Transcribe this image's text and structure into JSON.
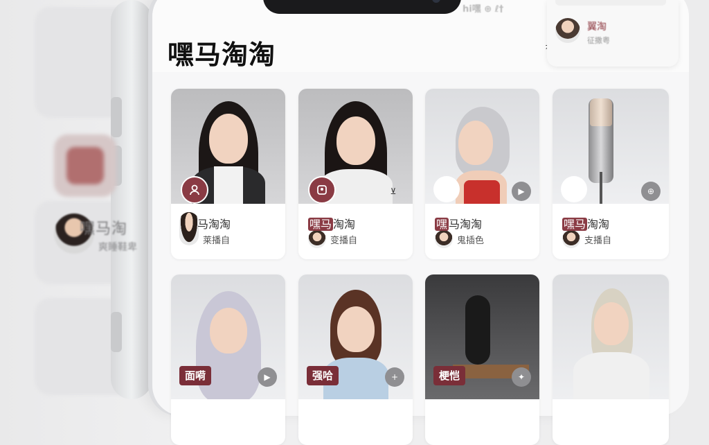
{
  "app": {
    "title": "嘿马淘淘",
    "header_action": "⤒"
  },
  "status_bar": {
    "text": "hi嘿 ⊕ ℓ†"
  },
  "floating_card": {
    "name": "翼淘",
    "sub": "征撒粤"
  },
  "background": {
    "name": "嘿马淘",
    "sub": "爽睡鞋卑"
  },
  "cards": [
    {
      "title_hl": "",
      "title": "马淘淘",
      "sub": "莱播自",
      "badge": "person",
      "action": ""
    },
    {
      "title_hl": "嘿马",
      "title": "淘淘",
      "sub": "变播自",
      "badge": "image",
      "action": "⊻"
    },
    {
      "title_hl": "嘿",
      "title": "马淘淘",
      "sub": "鬼插色",
      "badge": "blank",
      "action": "▶"
    },
    {
      "title_hl": "嘿马",
      "title": "淘淘",
      "sub": "支播自",
      "badge": "blank",
      "action": "⊕"
    },
    {
      "tag": "面嗬",
      "action": "▶"
    },
    {
      "tag": "强哈",
      "action": "+"
    },
    {
      "tag": "梗恺",
      "action": "✦"
    },
    {
      "tag": "",
      "action": ""
    }
  ],
  "colors": {
    "accent": "#8a3b44",
    "tag": "#7a2e38"
  }
}
